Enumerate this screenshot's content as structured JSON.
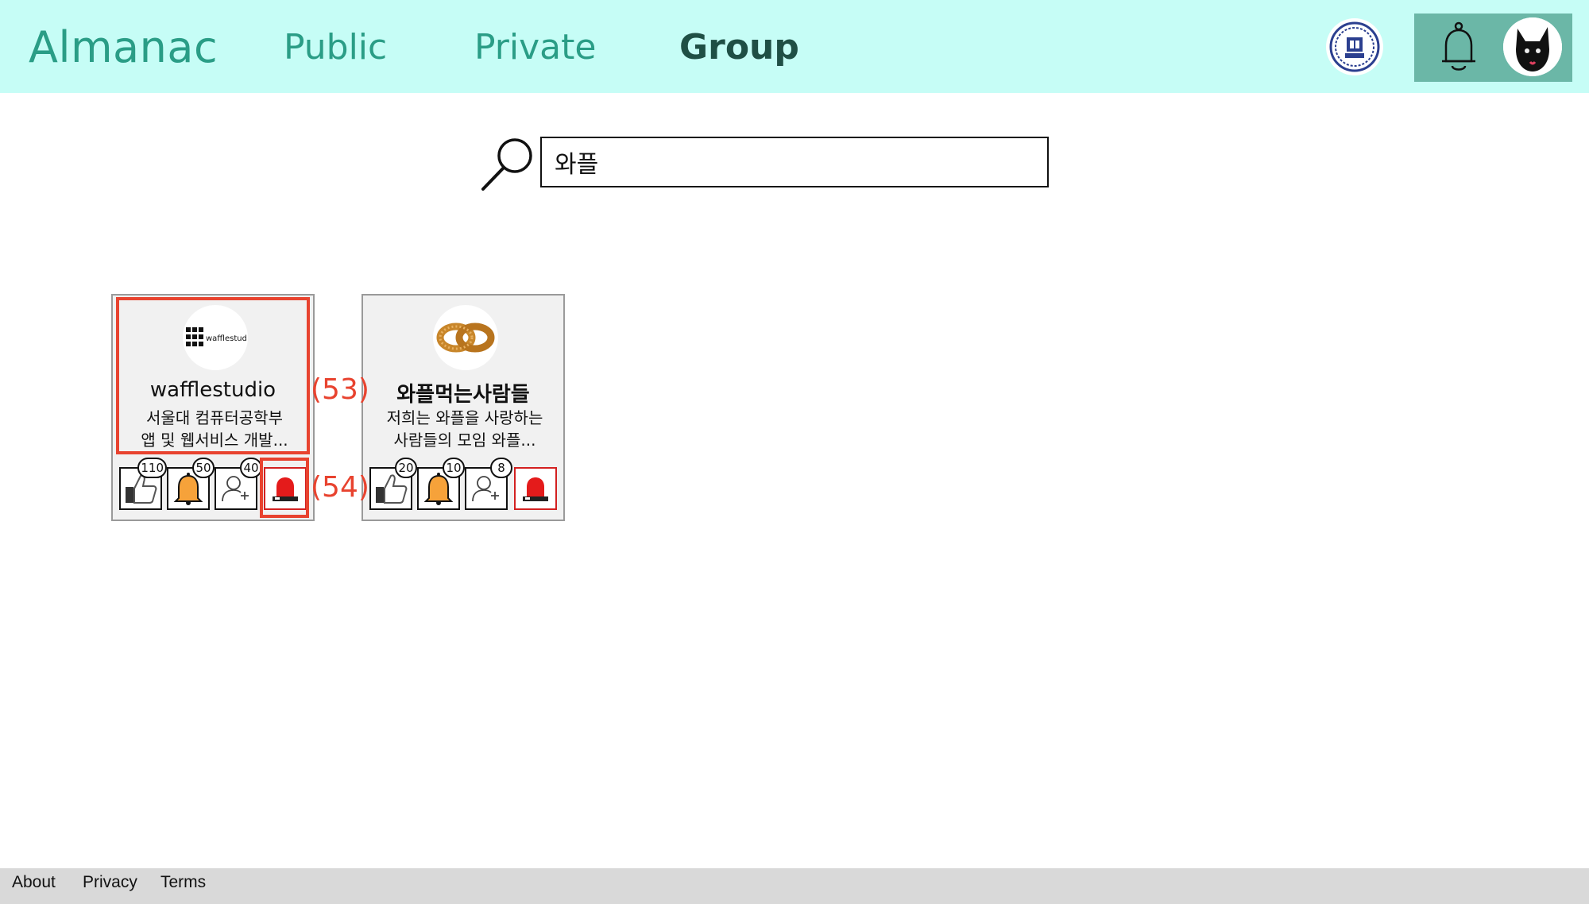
{
  "header": {
    "brand": "Almanac",
    "nav": [
      {
        "label": "Public",
        "active": false
      },
      {
        "label": "Private",
        "active": false
      },
      {
        "label": "Group",
        "active": true
      }
    ],
    "icons": {
      "school_logo": "university-seal-icon",
      "bell": "bell-icon",
      "avatar": "black-cat-avatar"
    }
  },
  "search": {
    "value": "와플",
    "icon": "search-icon"
  },
  "groups": [
    {
      "name": "wafflestudio",
      "logo": "wafflestudio-logo",
      "logo_text": "wafflestudio",
      "description_lines": [
        "서울대 컴퓨터공학부",
        "앱 및 웹서비스 개발..."
      ],
      "likes": "110",
      "notifications": "50",
      "members": "40"
    },
    {
      "name": "와플먹는사람들",
      "logo": "waffle-pretzel-logo",
      "description_lines": [
        "저희는 와플을 사랑하는",
        "사람들의 모임 와플..."
      ],
      "likes": "20",
      "notifications": "10",
      "members": "8"
    }
  ],
  "annotations": {
    "label_53": "(53)",
    "label_54": "(54)",
    "color": "#e8432f"
  },
  "footer": {
    "about": "About",
    "privacy": "Privacy",
    "terms": "Terms"
  },
  "colors": {
    "header_bg": "#c6fdf6",
    "accent": "#2a9d86",
    "panel": "#6bb7a7",
    "report": "#d32020"
  }
}
